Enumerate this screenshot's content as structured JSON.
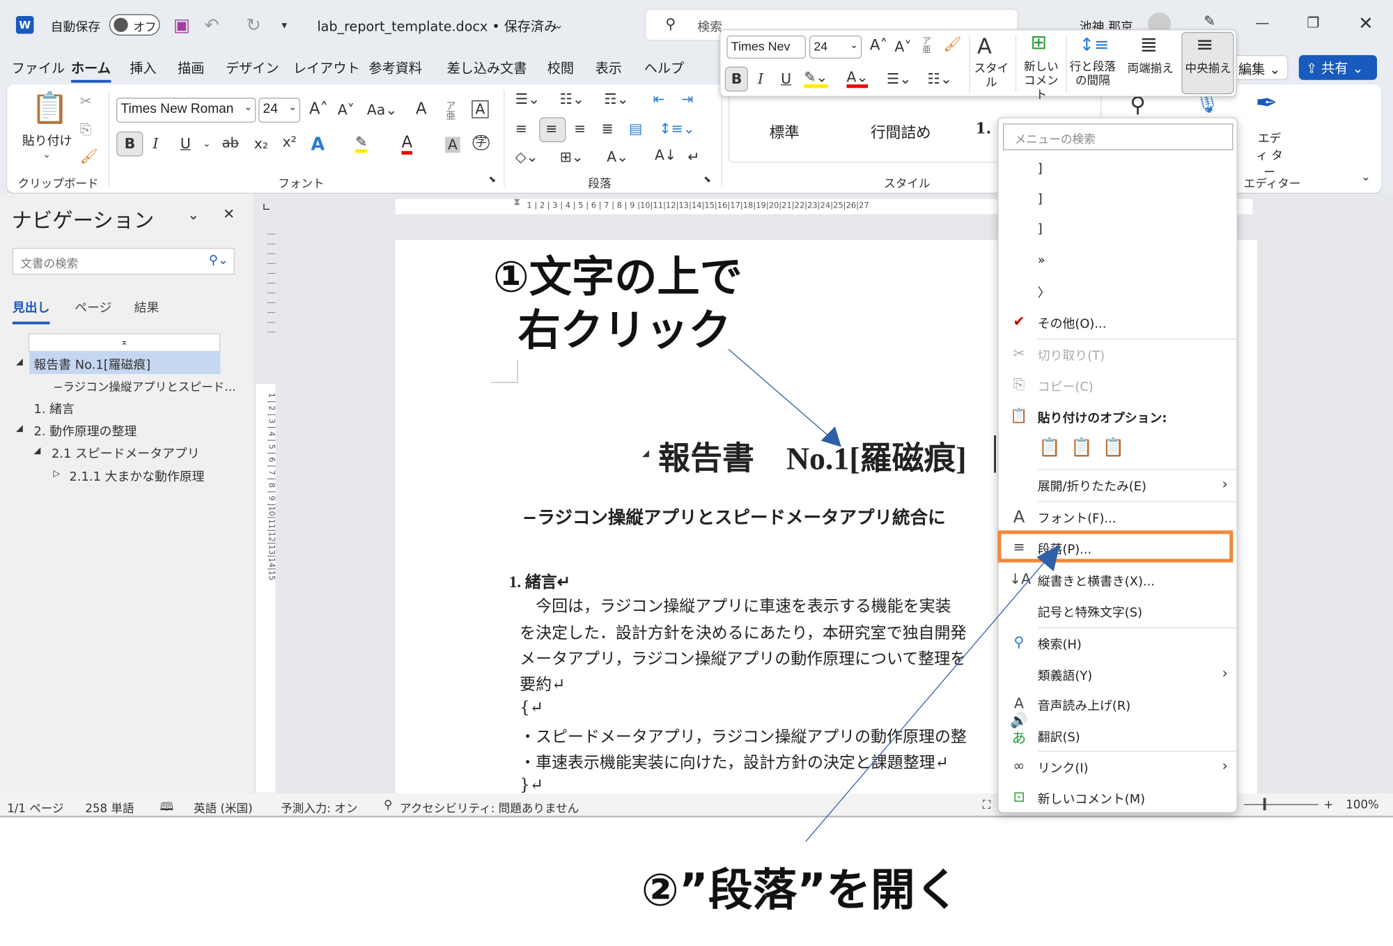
{
  "titlebar": {
    "autosave_label": "自動保存",
    "autosave_state": "オフ",
    "filename": "lab_report_template.docx • 保存済み",
    "search_placeholder": "検索",
    "user": "池神 那京"
  },
  "menu_tabs": [
    "ファイル",
    "ホーム",
    "挿入",
    "描画",
    "デザイン",
    "レイアウト",
    "参考資料",
    "差し込み文書",
    "校閲",
    "表示",
    "ヘルプ"
  ],
  "ribbon": {
    "paste_label": "貼り付け",
    "font_name": "Times New Roman",
    "font_size": "24",
    "groups": {
      "clipboard": "クリップボード",
      "font": "フォント",
      "paragraph": "段落",
      "styles": "スタイル",
      "editor": "エディター"
    },
    "styles": [
      "標準",
      "行間詰め",
      "1."
    ],
    "editor_label": "エディ ター",
    "edit_button": "編集",
    "share_button": "共有"
  },
  "mini_toolbar": {
    "font_name": "Times Nev",
    "font_size": "24",
    "styles": "スタイル",
    "new_comment": "新しい コメント",
    "spacing": "行と段落 の間隔",
    "justify": "両端揃え",
    "center": "中央揃え"
  },
  "navigation": {
    "title": "ナビゲーション",
    "search_placeholder": "文書の検索",
    "tabs": [
      "見出し",
      "ページ",
      "結果"
    ],
    "tree": [
      "報告書 No.1[羅磁痕]",
      "−ラジコン操縦アプリとスピード…",
      "1. 緒言",
      "2. 動作原理の整理",
      "2.1 スピードメータアプリ",
      "2.1.1 大まかな動作原理"
    ]
  },
  "ruler": "1 | 2 | 3 | 4 | 5 | 6 | 7 | 8 | 9 |10|11|12|13|14|15|16|17|18|19|20|21|22|23|24|25|26|27",
  "vruler": "1 | 2 | 3 | 4 | 5 | 6 | 7 | 8 | 9 |10|11|12|13|14|15",
  "document": {
    "heading": "報告書　No.1[羅磁痕]",
    "subtitle": "−ラジコン操縦アプリとスピードメータアプリ統合に",
    "section": "1. 緒言↵",
    "lines": [
      "今回は，ラジコン操縦アプリに車速を表示する機能を実装",
      "を決定した．設計方針を決めるにあたり，本研究室で独自開発",
      "メータアプリ，ラジコン操縦アプリの動作原理について整理を",
      "要約↵",
      "{↵",
      "・スピードメータアプリ，ラジコン操縦アプリの動作原理の整",
      "・車速表示機能実装に向けた，設計方針の決定と課題整理↵",
      "}↵"
    ]
  },
  "context_menu": {
    "search_placeholder": "メニューの検索",
    "items": [
      "]",
      "]",
      "]",
      "»",
      "〉",
      "その他(O)...",
      "切り取り(T)",
      "コピー(C)",
      "貼り付けのオプション:",
      "展開/折りたたみ(E)",
      "フォント(F)...",
      "段落(P)...",
      "縦書きと横書き(X)...",
      "記号と特殊文字(S)",
      "検索(H)",
      "類義語(Y)",
      "音声読み上げ(R)",
      "翻訳(S)",
      "リンク(I)",
      "新しいコメント(M)"
    ],
    "highlighted": "段落(P)..."
  },
  "status": {
    "page": "1/1 ページ",
    "words": "258 単語",
    "language": "英語 (米国)",
    "predict": "予測入力: オン",
    "accessibility": "アクセシビリティ: 問題ありません",
    "zoom": "100%",
    "zoom_percent": 100
  },
  "annotations": {
    "step1_line1": "①文字の上で",
    "step1_line2": "右クリック",
    "step2": "②”段落”を開く",
    "highlight_color": "#f0883a",
    "arrow_color": "#2f5fa7"
  },
  "colors": {
    "accent": "#185abd",
    "ribbon_bg": "#e9ecf0"
  }
}
